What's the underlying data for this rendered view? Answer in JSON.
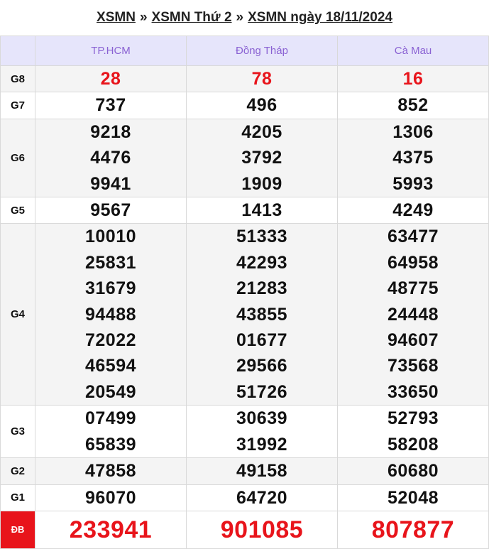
{
  "breadcrumb": [
    "XSMN",
    "XSMN Thứ 2",
    "XSMN ngày 18/11/2024"
  ],
  "breadcrumb_sep": "»",
  "provinces": [
    "TP.HCM",
    "Đồng Tháp",
    "Cà Mau"
  ],
  "prizes": [
    {
      "label": "G8",
      "values": [
        [
          "28"
        ],
        [
          "78"
        ],
        [
          "16"
        ]
      ],
      "highlight": true
    },
    {
      "label": "G7",
      "values": [
        [
          "737"
        ],
        [
          "496"
        ],
        [
          "852"
        ]
      ]
    },
    {
      "label": "G6",
      "values": [
        [
          "9218",
          "4476",
          "9941"
        ],
        [
          "4205",
          "3792",
          "1909"
        ],
        [
          "1306",
          "4375",
          "5993"
        ]
      ]
    },
    {
      "label": "G5",
      "values": [
        [
          "9567"
        ],
        [
          "1413"
        ],
        [
          "4249"
        ]
      ]
    },
    {
      "label": "G4",
      "values": [
        [
          "10010",
          "25831",
          "31679",
          "94488",
          "72022",
          "46594",
          "20549"
        ],
        [
          "51333",
          "42293",
          "21283",
          "43855",
          "01677",
          "29566",
          "51726"
        ],
        [
          "63477",
          "64958",
          "48775",
          "24448",
          "94607",
          "73568",
          "33650"
        ]
      ]
    },
    {
      "label": "G3",
      "values": [
        [
          "07499",
          "65839"
        ],
        [
          "30639",
          "31992"
        ],
        [
          "52793",
          "58208"
        ]
      ]
    },
    {
      "label": "G2",
      "values": [
        [
          "47858"
        ],
        [
          "49158"
        ],
        [
          "60680"
        ]
      ]
    },
    {
      "label": "G1",
      "values": [
        [
          "96070"
        ],
        [
          "64720"
        ],
        [
          "52048"
        ]
      ]
    },
    {
      "label": "ĐB",
      "values": [
        [
          "233941"
        ],
        [
          "901085"
        ],
        [
          "807877"
        ]
      ],
      "special": true
    }
  ],
  "colors": {
    "accent": "#8a62d3",
    "header_bg": "#e6e5fb",
    "red": "#e8141b"
  }
}
